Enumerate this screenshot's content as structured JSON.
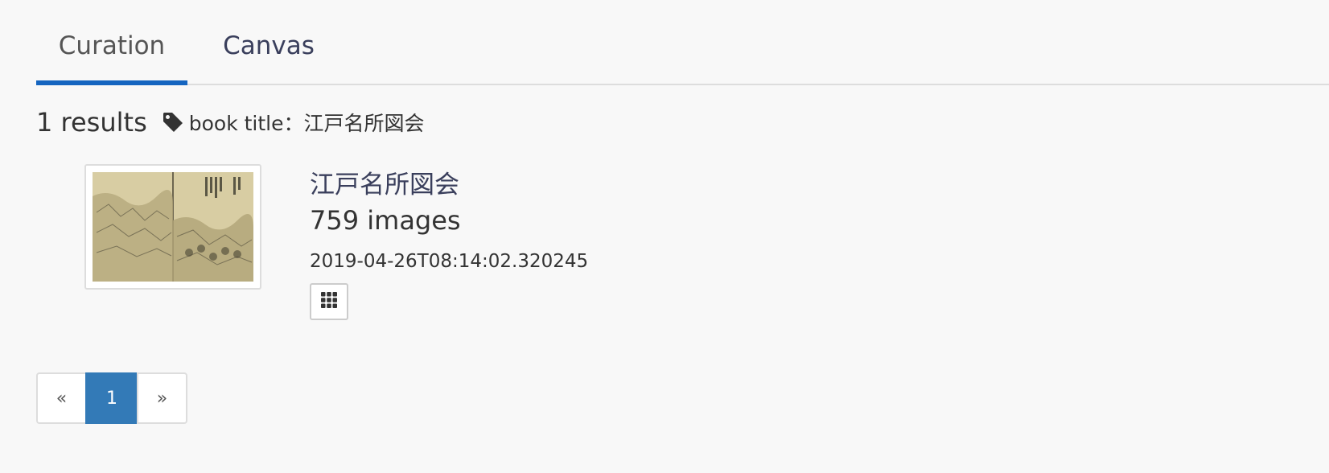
{
  "tabs": [
    {
      "label": "Curation",
      "active": true
    },
    {
      "label": "Canvas",
      "active": false
    }
  ],
  "results": {
    "count_text": "1 results",
    "filter_icon": "tag-icon",
    "filter_text": "book title：江戸名所図会"
  },
  "item": {
    "title": "江戸名所図会",
    "image_count": "759 images",
    "timestamp": "2019-04-26T08:14:02.320245",
    "grid_icon": "grid-icon"
  },
  "pagination": {
    "prev": "«",
    "current": "1",
    "next": "»"
  },
  "colors": {
    "accent": "#1565c0",
    "page_active": "#337ab7",
    "link": "#3a3f5c"
  }
}
